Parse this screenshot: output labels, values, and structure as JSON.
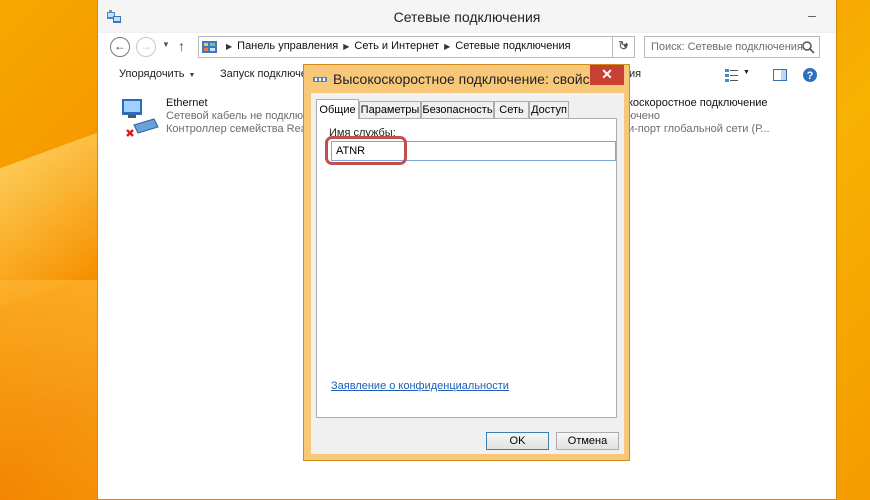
{
  "explorer": {
    "title": "Сетевые подключения",
    "breadcrumbs": [
      "Панель управления",
      "Сеть и Интернет",
      "Сетевые подключения"
    ],
    "search_placeholder": "Поиск: Сетевые подключения",
    "toolbar": {
      "organize": "Упорядочить",
      "launch": "Запуск подключе",
      "partial_right": "ия"
    }
  },
  "connections": [
    {
      "name": "Ethernet",
      "status": "Сетевой кабель не подключ",
      "device": "Контроллер семейства Realte",
      "icon": "network-adapter-disconnected-icon"
    },
    {
      "name": "коскоростное подключение",
      "status": "ючено",
      "device": "и-порт глобальной сети (Р...",
      "icon": "broadband-connection-icon"
    }
  ],
  "dialog": {
    "title": "Высокоскоростное подключение: свойства",
    "tabs": [
      "Общие",
      "Параметры",
      "Безопасность",
      "Сеть",
      "Доступ"
    ],
    "active_tab": "Общие",
    "service_label": "Имя службы:",
    "service_value": "ATNR",
    "privacy_link": "Заявление о конфиденциальности",
    "ok": "OK",
    "cancel": "Отмена",
    "highlight_color": "#c0504d"
  }
}
